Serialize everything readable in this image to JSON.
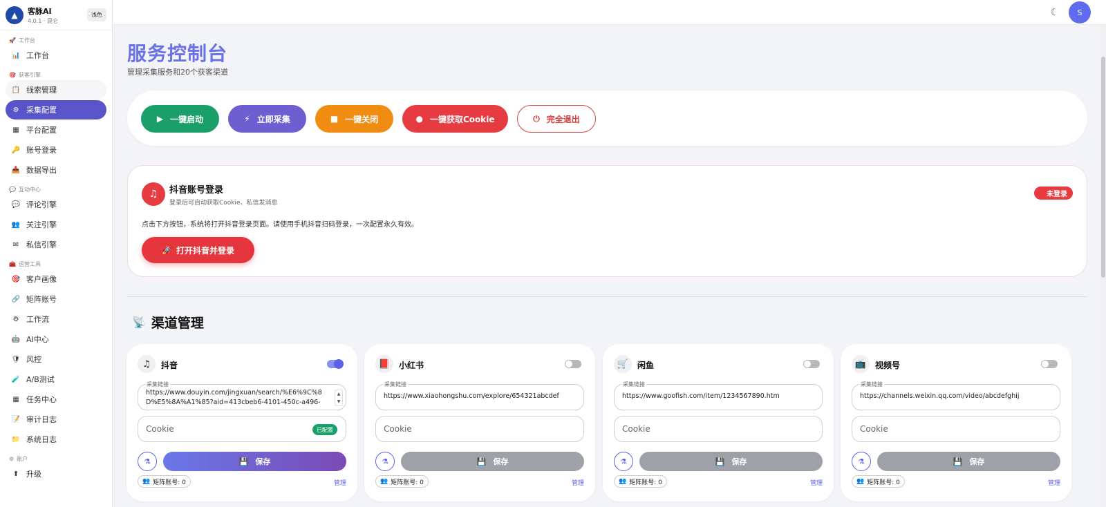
{
  "brand": {
    "name": "客脉AI",
    "version": "4.0.1 · 昆仑",
    "theme_btn": "浅色"
  },
  "sidebar": {
    "sections": [
      {
        "title": "工作台",
        "icon": "🚀",
        "items": [
          {
            "label": "工作台",
            "icon": "📊"
          }
        ]
      },
      {
        "title": "获客引擎",
        "icon": "🎯",
        "items": [
          {
            "label": "线索管理",
            "icon": "📋"
          },
          {
            "label": "采集配置",
            "icon": "⚙"
          },
          {
            "label": "平台配置",
            "icon": "▦"
          },
          {
            "label": "账号登录",
            "icon": "🔑"
          },
          {
            "label": "数据导出",
            "icon": "📥"
          }
        ]
      },
      {
        "title": "互动中心",
        "icon": "💬",
        "items": [
          {
            "label": "评论引擎",
            "icon": "💬"
          },
          {
            "label": "关注引擎",
            "icon": "👥"
          },
          {
            "label": "私信引擎",
            "icon": "✉"
          }
        ]
      },
      {
        "title": "运营工具",
        "icon": "🧰",
        "items": [
          {
            "label": "客户画像",
            "icon": "🎯"
          },
          {
            "label": "矩阵账号",
            "icon": "🔗"
          },
          {
            "label": "工作流",
            "icon": "⚙"
          },
          {
            "label": "AI中心",
            "icon": "🤖"
          },
          {
            "label": "风控",
            "icon": "🛡"
          },
          {
            "label": "A/B测试",
            "icon": "🧪"
          },
          {
            "label": "任务中心",
            "icon": "▦"
          },
          {
            "label": "审计日志",
            "icon": "📝"
          },
          {
            "label": "系统日志",
            "icon": "📁"
          }
        ]
      },
      {
        "title": "账户",
        "icon": "⚙",
        "items": [
          {
            "label": "升级",
            "icon": "⬆"
          }
        ]
      }
    ]
  },
  "topbar": {
    "avatar_letter": "S"
  },
  "page": {
    "title": "服务控制台",
    "subtitle": "管理采集服务和20个获客渠道"
  },
  "actions": {
    "start": "一键启动",
    "collect": "立即采集",
    "close": "一键关闭",
    "cookie": "一键获取Cookie",
    "exit": "完全退出"
  },
  "login": {
    "title": "抖音账号登录",
    "subtitle": "登录后可自动获取Cookie、私信发消息",
    "status": "未登录",
    "description": "点击下方按钮，系统将打开抖音登录页面。请使用手机抖音扫码登录，一次配置永久有效。",
    "button": "打开抖音并登录"
  },
  "channels_title": "渠道管理",
  "channels": [
    {
      "name": "抖音",
      "icon": "♫",
      "enabled": true,
      "url_label": "采集链接",
      "url": "https://www.douyin.com/jingxuan/search/%E6%9C%8D%E5%8A%A1%85?aid=413cbeb6-4101-450c-a496-",
      "cookie_placeholder": "Cookie",
      "cookie_badge": "已配置",
      "save": "保存",
      "matrix": "矩阵账号: 0",
      "manage": "管理"
    },
    {
      "name": "小红书",
      "icon": "📕",
      "enabled": false,
      "url_label": "采集链接",
      "url": "https://www.xiaohongshu.com/explore/654321abcdef",
      "cookie_placeholder": "Cookie",
      "cookie_badge": "",
      "save": "保存",
      "matrix": "矩阵账号: 0",
      "manage": "管理"
    },
    {
      "name": "闲鱼",
      "icon": "🛒",
      "enabled": false,
      "url_label": "采集链接",
      "url": "https://www.goofish.com/item/1234567890.htm",
      "cookie_placeholder": "Cookie",
      "cookie_badge": "",
      "save": "保存",
      "matrix": "矩阵账号: 0",
      "manage": "管理"
    },
    {
      "name": "视频号",
      "icon": "📺",
      "enabled": false,
      "url_label": "采集链接",
      "url": "https://channels.weixin.qq.com/video/abcdefghij",
      "cookie_placeholder": "Cookie",
      "cookie_badge": "",
      "save": "保存",
      "matrix": "矩阵账号: 0",
      "manage": "管理"
    }
  ],
  "colors": {
    "accent": "#5954c9",
    "title": "#6a72e6",
    "green": "#1b9f6a",
    "red": "#e63b41",
    "orange": "#f08c12"
  }
}
